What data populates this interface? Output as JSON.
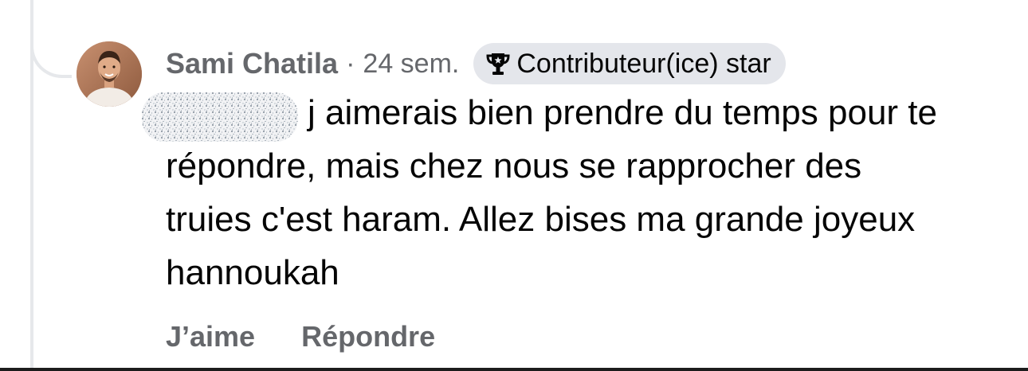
{
  "comment": {
    "author": "Sami Chatila",
    "separator": "·",
    "timestamp": "24 sem.",
    "badge": {
      "icon": "trophy-icon",
      "label": "Contributeur(ice) star"
    },
    "body": "j aimerais bien prendre du temps pour te répondre, mais chez nous se rapprocher des truies c'est haram. Allez bises ma grande joyeux hannoukah",
    "actions": {
      "like": "J’aime",
      "reply": "Répondre"
    }
  },
  "colors": {
    "secondary_text": "#65676b",
    "primary_text": "#050505",
    "badge_background": "#e4e6eb",
    "thread_line": "#e6e8eb"
  }
}
